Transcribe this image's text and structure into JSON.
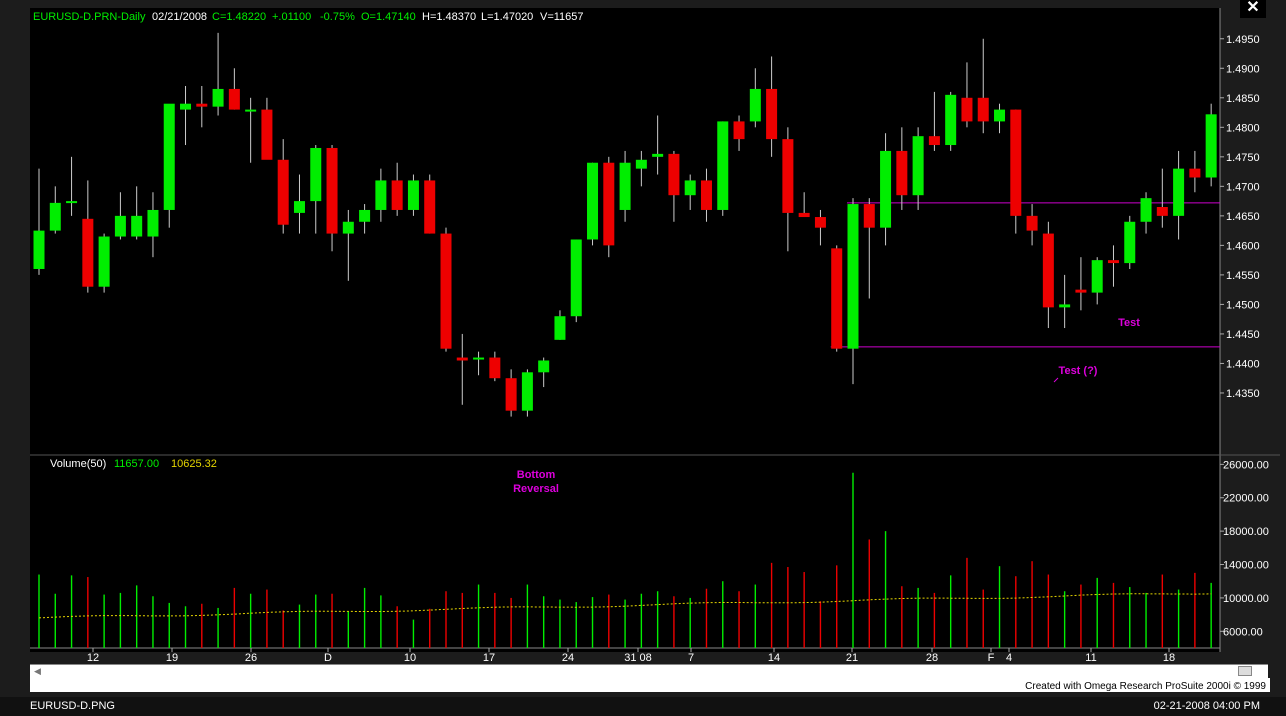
{
  "header": {
    "symbol": "EURUSD-D.PRN-Daily",
    "date": "02/21/2008",
    "close": "C=1.48220",
    "change": "+.01100",
    "pct": "-0.75%",
    "open": "O=1.47140",
    "high": "H=1.48370",
    "low": "L=1.47020",
    "volume": "V=11657"
  },
  "volume_header": {
    "label": "Volume(50)",
    "value1": "11657.00",
    "value2": "10625.32"
  },
  "annotations": {
    "bottom_reversal_1": "Bottom",
    "bottom_reversal_2": "Reversal",
    "test_q": "Test (?)",
    "test": "Test"
  },
  "footer": {
    "credit": "Created with Omega Research ProSuite 2000i © 1999",
    "file": "EURUSD-D.PNG",
    "time": "02-21-2008 04:00 PM"
  },
  "colors": {
    "up": "#00ee00",
    "down": "#ee0000",
    "line": "#cc00cc",
    "ma": "#e5d500",
    "grid": "#444444"
  },
  "chart_data": [
    {
      "type": "candlestick",
      "title": "EURUSD-D.PRN-Daily",
      "ylim": [
        1.425,
        1.4975
      ],
      "y_ticks": [
        "1.4350",
        "1.4400",
        "1.4450",
        "1.4500",
        "1.4550",
        "1.4600",
        "1.4650",
        "1.4700",
        "1.4750",
        "1.4800",
        "1.4850",
        "1.4900",
        "1.4950"
      ],
      "x_tick_labels": [
        "12",
        "19",
        "26",
        "D",
        "10",
        "17",
        "24",
        "31 08",
        "7",
        "14",
        "21",
        "28",
        "F",
        "4",
        "11",
        "18"
      ],
      "hlines": [
        1.4672,
        1.4428
      ],
      "candles": [
        {
          "o": 1.456,
          "h": 1.473,
          "l": 1.455,
          "c": 1.4625
        },
        {
          "o": 1.4625,
          "h": 1.47,
          "l": 1.462,
          "c": 1.4672
        },
        {
          "o": 1.4672,
          "h": 1.475,
          "l": 1.465,
          "c": 1.4675
        },
        {
          "o": 1.4645,
          "h": 1.471,
          "l": 1.452,
          "c": 1.453
        },
        {
          "o": 1.453,
          "h": 1.462,
          "l": 1.452,
          "c": 1.4615
        },
        {
          "o": 1.4615,
          "h": 1.469,
          "l": 1.461,
          "c": 1.465
        },
        {
          "o": 1.4615,
          "h": 1.47,
          "l": 1.461,
          "c": 1.465
        },
        {
          "o": 1.4615,
          "h": 1.469,
          "l": 1.458,
          "c": 1.466
        },
        {
          "o": 1.466,
          "h": 1.482,
          "l": 1.463,
          "c": 1.484
        },
        {
          "o": 1.483,
          "h": 1.487,
          "l": 1.477,
          "c": 1.484
        },
        {
          "o": 1.484,
          "h": 1.487,
          "l": 1.48,
          "c": 1.4835
        },
        {
          "o": 1.4835,
          "h": 1.496,
          "l": 1.482,
          "c": 1.4865
        },
        {
          "o": 1.4865,
          "h": 1.49,
          "l": 1.483,
          "c": 1.483
        },
        {
          "o": 1.483,
          "h": 1.485,
          "l": 1.474,
          "c": 1.483
        },
        {
          "o": 1.483,
          "h": 1.485,
          "l": 1.475,
          "c": 1.4745
        },
        {
          "o": 1.4745,
          "h": 1.478,
          "l": 1.462,
          "c": 1.4635
        },
        {
          "o": 1.4655,
          "h": 1.472,
          "l": 1.462,
          "c": 1.4675
        },
        {
          "o": 1.4675,
          "h": 1.477,
          "l": 1.462,
          "c": 1.4765
        },
        {
          "o": 1.4765,
          "h": 1.477,
          "l": 1.459,
          "c": 1.462
        },
        {
          "o": 1.462,
          "h": 1.466,
          "l": 1.454,
          "c": 1.464
        },
        {
          "o": 1.464,
          "h": 1.467,
          "l": 1.462,
          "c": 1.466
        },
        {
          "o": 1.466,
          "h": 1.473,
          "l": 1.464,
          "c": 1.471
        },
        {
          "o": 1.471,
          "h": 1.474,
          "l": 1.465,
          "c": 1.466
        },
        {
          "o": 1.466,
          "h": 1.472,
          "l": 1.465,
          "c": 1.471
        },
        {
          "o": 1.471,
          "h": 1.472,
          "l": 1.462,
          "c": 1.462
        },
        {
          "o": 1.462,
          "h": 1.463,
          "l": 1.442,
          "c": 1.4425
        },
        {
          "o": 1.441,
          "h": 1.445,
          "l": 1.433,
          "c": 1.4405
        },
        {
          "o": 1.441,
          "h": 1.442,
          "l": 1.438,
          "c": 1.441
        },
        {
          "o": 1.441,
          "h": 1.442,
          "l": 1.437,
          "c": 1.4375
        },
        {
          "o": 1.4375,
          "h": 1.439,
          "l": 1.431,
          "c": 1.432
        },
        {
          "o": 1.432,
          "h": 1.439,
          "l": 1.431,
          "c": 1.4385
        },
        {
          "o": 1.4385,
          "h": 1.441,
          "l": 1.436,
          "c": 1.4405
        },
        {
          "o": 1.444,
          "h": 1.449,
          "l": 1.444,
          "c": 1.448
        },
        {
          "o": 1.448,
          "h": 1.461,
          "l": 1.447,
          "c": 1.461
        },
        {
          "o": 1.461,
          "h": 1.474,
          "l": 1.46,
          "c": 1.474
        },
        {
          "o": 1.474,
          "h": 1.475,
          "l": 1.458,
          "c": 1.46
        },
        {
          "o": 1.466,
          "h": 1.476,
          "l": 1.464,
          "c": 1.474
        },
        {
          "o": 1.473,
          "h": 1.476,
          "l": 1.47,
          "c": 1.4745
        },
        {
          "o": 1.475,
          "h": 1.482,
          "l": 1.472,
          "c": 1.4755
        },
        {
          "o": 1.4755,
          "h": 1.476,
          "l": 1.464,
          "c": 1.4685
        },
        {
          "o": 1.4685,
          "h": 1.472,
          "l": 1.466,
          "c": 1.471
        },
        {
          "o": 1.471,
          "h": 1.473,
          "l": 1.464,
          "c": 1.466
        },
        {
          "o": 1.466,
          "h": 1.481,
          "l": 1.465,
          "c": 1.481
        },
        {
          "o": 1.481,
          "h": 1.482,
          "l": 1.476,
          "c": 1.478
        },
        {
          "o": 1.481,
          "h": 1.49,
          "l": 1.48,
          "c": 1.4865
        },
        {
          "o": 1.4865,
          "h": 1.492,
          "l": 1.475,
          "c": 1.478
        },
        {
          "o": 1.478,
          "h": 1.48,
          "l": 1.459,
          "c": 1.4655
        },
        {
          "o": 1.4655,
          "h": 1.469,
          "l": 1.465,
          "c": 1.4648
        },
        {
          "o": 1.4648,
          "h": 1.466,
          "l": 1.46,
          "c": 1.463
        },
        {
          "o": 1.4595,
          "h": 1.46,
          "l": 1.442,
          "c": 1.4425
        },
        {
          "o": 1.4425,
          "h": 1.468,
          "l": 1.4365,
          "c": 1.467
        },
        {
          "o": 1.467,
          "h": 1.468,
          "l": 1.451,
          "c": 1.463
        },
        {
          "o": 1.463,
          "h": 1.479,
          "l": 1.46,
          "c": 1.476
        },
        {
          "o": 1.476,
          "h": 1.48,
          "l": 1.466,
          "c": 1.4685
        },
        {
          "o": 1.4685,
          "h": 1.48,
          "l": 1.466,
          "c": 1.4785
        },
        {
          "o": 1.4785,
          "h": 1.486,
          "l": 1.476,
          "c": 1.477
        },
        {
          "o": 1.477,
          "h": 1.486,
          "l": 1.476,
          "c": 1.4855
        },
        {
          "o": 1.485,
          "h": 1.491,
          "l": 1.48,
          "c": 1.481
        },
        {
          "o": 1.485,
          "h": 1.495,
          "l": 1.479,
          "c": 1.481
        },
        {
          "o": 1.481,
          "h": 1.484,
          "l": 1.479,
          "c": 1.483
        },
        {
          "o": 1.483,
          "h": 1.483,
          "l": 1.462,
          "c": 1.465
        },
        {
          "o": 1.465,
          "h": 1.467,
          "l": 1.46,
          "c": 1.4625
        },
        {
          "o": 1.462,
          "h": 1.464,
          "l": 1.446,
          "c": 1.4495
        },
        {
          "o": 1.4495,
          "h": 1.455,
          "l": 1.446,
          "c": 1.45
        },
        {
          "o": 1.4525,
          "h": 1.458,
          "l": 1.449,
          "c": 1.452
        },
        {
          "o": 1.452,
          "h": 1.458,
          "l": 1.45,
          "c": 1.4575
        },
        {
          "o": 1.4575,
          "h": 1.46,
          "l": 1.453,
          "c": 1.457
        },
        {
          "o": 1.457,
          "h": 1.465,
          "l": 1.456,
          "c": 1.464
        },
        {
          "o": 1.464,
          "h": 1.469,
          "l": 1.462,
          "c": 1.468
        },
        {
          "o": 1.4665,
          "h": 1.473,
          "l": 1.463,
          "c": 1.465
        },
        {
          "o": 1.465,
          "h": 1.476,
          "l": 1.461,
          "c": 1.473
        },
        {
          "o": 1.473,
          "h": 1.476,
          "l": 1.469,
          "c": 1.4715
        },
        {
          "o": 1.4715,
          "h": 1.484,
          "l": 1.47,
          "c": 1.4822
        }
      ]
    },
    {
      "type": "bar",
      "title": "Volume(50)",
      "ylim": [
        4000,
        27000
      ],
      "y_ticks": [
        "6000.00",
        "10000.00",
        "14000.00",
        "18000.00",
        "22000.00",
        "26000.00"
      ],
      "volume": [
        12800,
        10500,
        12700,
        12500,
        10400,
        10600,
        11500,
        10200,
        9400,
        9000,
        9300,
        8800,
        11200,
        10500,
        11000,
        8500,
        9200,
        10400,
        10500,
        8400,
        11200,
        10300,
        9000,
        7400,
        8700,
        10800,
        10600,
        11600,
        10600,
        10000,
        11600,
        10200,
        9800,
        9500,
        10100,
        10400,
        9800,
        10500,
        10800,
        10200,
        10000,
        11100,
        12000,
        10800,
        11600,
        14200,
        13700,
        13100,
        9600,
        13900,
        25000,
        17000,
        18000,
        11400,
        11200,
        10600,
        12700,
        14800,
        11000,
        13800,
        12600,
        14400,
        12800,
        10800,
        11600,
        12400,
        11800,
        11300,
        10600,
        12800,
        11000,
        13000,
        11800
      ],
      "moving_average_start": 7600,
      "moving_average_end": 10600
    }
  ]
}
